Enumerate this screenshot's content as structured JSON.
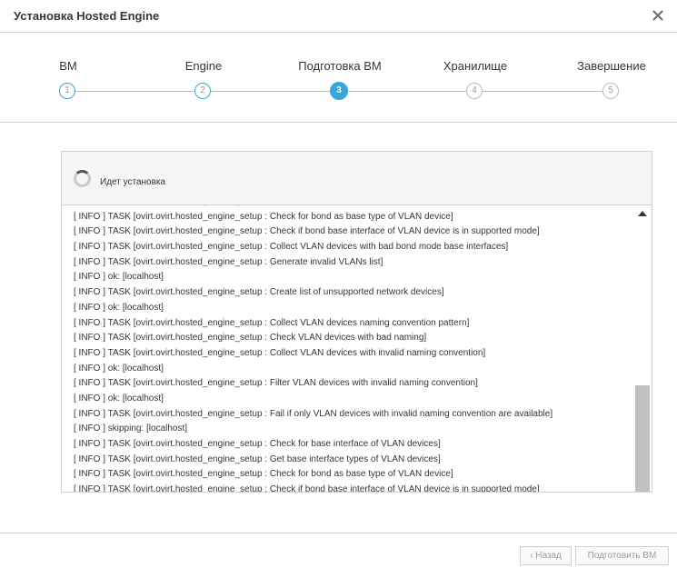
{
  "dialog": {
    "title": "Установка Hosted Engine",
    "close_icon": "close-icon"
  },
  "wizard": {
    "steps": [
      {
        "label": "ВМ",
        "number": "1",
        "state": "done"
      },
      {
        "label": "Engine",
        "number": "2",
        "state": "done"
      },
      {
        "label": "Подготовка ВМ",
        "number": "3",
        "state": "active"
      },
      {
        "label": "Хранилище",
        "number": "4",
        "state": "todo"
      },
      {
        "label": "Завершение",
        "number": "5",
        "state": "todo"
      }
    ],
    "accent_color": "#39a5dc"
  },
  "status": {
    "spinner_icon": "spinner-icon",
    "text": "Идет установка"
  },
  "log": {
    "lines": [
      "[ INFO ] TASK [ovirt.ovirt.hosted_engine_setup : Get base interface types of VLAN devices]",
      "[ INFO ] TASK [ovirt.ovirt.hosted_engine_setup : Check for bond as base type of VLAN device]",
      "[ INFO ] TASK [ovirt.ovirt.hosted_engine_setup : Check if bond base interface of VLAN device is in supported mode]",
      "[ INFO ] TASK [ovirt.ovirt.hosted_engine_setup : Collect VLAN devices with bad bond mode base interfaces]",
      "[ INFO ] TASK [ovirt.ovirt.hosted_engine_setup : Generate invalid VLANs list]",
      "[ INFO ] ok: [localhost]",
      "[ INFO ] TASK [ovirt.ovirt.hosted_engine_setup : Create list of unsupported network devices]",
      "[ INFO ] ok: [localhost]",
      "[ INFO ] TASK [ovirt.ovirt.hosted_engine_setup : Collect VLAN devices naming convention pattern]",
      "[ INFO ] TASK [ovirt.ovirt.hosted_engine_setup : Check VLAN devices with bad naming]",
      "[ INFO ] TASK [ovirt.ovirt.hosted_engine_setup : Collect VLAN devices with invalid naming convention]",
      "[ INFO ] ok: [localhost]",
      "[ INFO ] TASK [ovirt.ovirt.hosted_engine_setup : Filter VLAN devices with invalid naming convention]",
      "[ INFO ] ok: [localhost]",
      "[ INFO ] TASK [ovirt.ovirt.hosted_engine_setup : Fail if only VLAN devices with invalid naming convention are available]",
      "[ INFO ] skipping: [localhost]",
      "[ INFO ] TASK [ovirt.ovirt.hosted_engine_setup : Check for base interface of VLAN devices]",
      "[ INFO ] TASK [ovirt.ovirt.hosted_engine_setup : Get base interface types of VLAN devices]",
      "[ INFO ] TASK [ovirt.ovirt.hosted_engine_setup : Check for bond as base type of VLAN device]",
      "[ INFO ] TASK [ovirt.ovirt.hosted_engine_setup : Check if bond base interface of VLAN device is in supported mode]"
    ]
  },
  "footer": {
    "back_label": "‹ Назад",
    "next_label": "Подготовить ВМ"
  }
}
